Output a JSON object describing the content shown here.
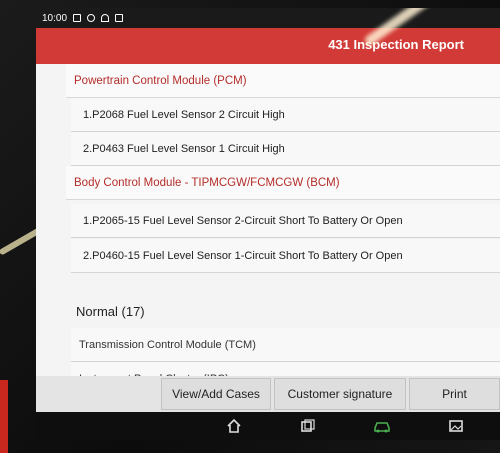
{
  "status_bar": {
    "time": "10:00"
  },
  "header": {
    "title": "431 Inspection Report"
  },
  "modules": [
    {
      "name": "Powertrain Control Module (PCM)",
      "faults": [
        "1.P2068 Fuel Level Sensor 2 Circuit High",
        "2.P0463 Fuel Level Sensor 1 Circuit High"
      ]
    },
    {
      "name": "Body Control Module - TIPMCGW/FCMCGW (BCM)",
      "faults": [
        "1.P2065-15 Fuel Level Sensor 2-Circuit Short To Battery Or Open",
        "2.P0460-15 Fuel Level Sensor 1-Circuit Short To Battery Or Open"
      ]
    }
  ],
  "normal_section": {
    "label": "Normal (17)",
    "items": [
      "Transmission Control Module (TCM)",
      "Instrument Panel Cluster (IPC)"
    ]
  },
  "buttons": {
    "view_add_cases": "View/Add Cases",
    "customer_signature": "Customer signature",
    "print": "Print"
  },
  "icons": {
    "scroll_down": "chevron-down-icon",
    "nav": [
      "home-icon",
      "recent-apps-icon",
      "vci-car-icon",
      "screenshot-icon"
    ]
  },
  "colors": {
    "header": "#d23a37",
    "module_text": "#b42d2a"
  }
}
